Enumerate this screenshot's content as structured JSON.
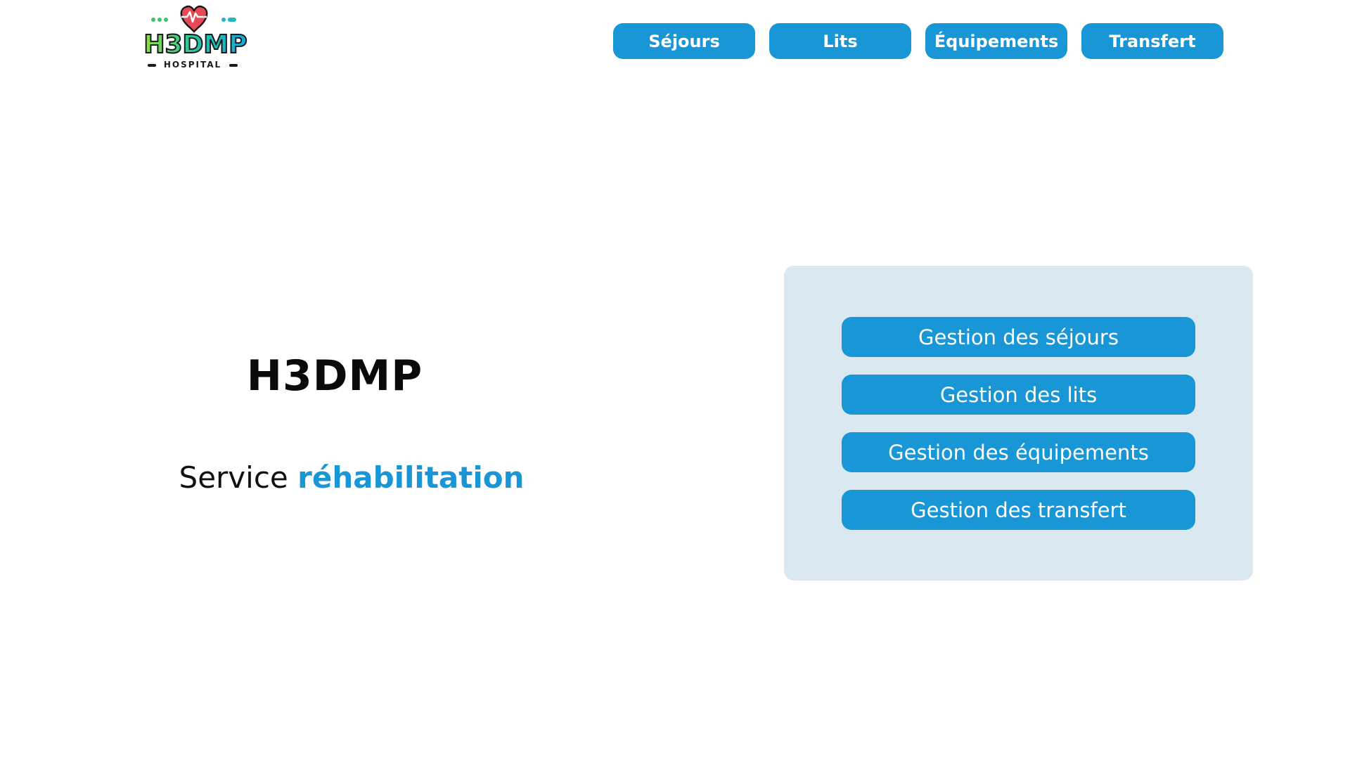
{
  "logo": {
    "wordmark": "H3DMP",
    "tagline": "HOSPITAL",
    "icon": "heart-pulse-icon"
  },
  "nav": {
    "items": [
      {
        "label": "Séjours"
      },
      {
        "label": "Lits"
      },
      {
        "label": "Équipements"
      },
      {
        "label": "Transfert"
      }
    ]
  },
  "hero": {
    "title": "H3DMP",
    "subtitle_prefix": "Service",
    "subtitle_accent": "réhabilitation"
  },
  "panel": {
    "actions": [
      {
        "label": "Gestion des séjours"
      },
      {
        "label": "Gestion des lits"
      },
      {
        "label": "Gestion des équipements"
      },
      {
        "label": "Gestion des transfert"
      }
    ]
  },
  "colors": {
    "accent": "#1896d6",
    "panel_bg": "#dae8f2",
    "text": "#0a0a0a",
    "background": "#ffffff"
  }
}
